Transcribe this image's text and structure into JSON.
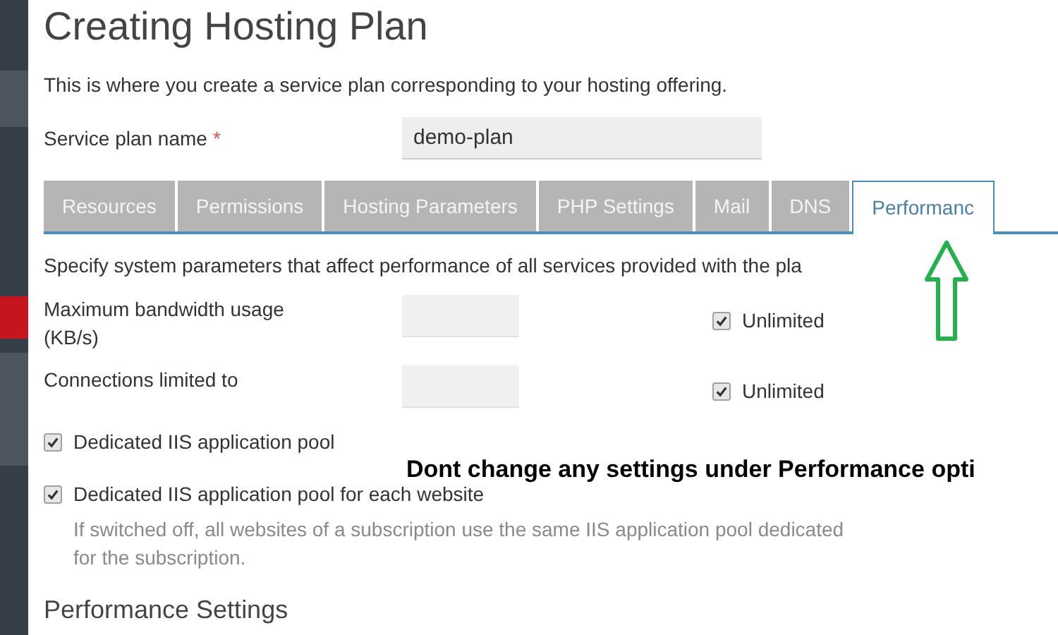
{
  "page": {
    "title": "Creating Hosting Plan",
    "intro": "This is where you create a service plan corresponding to your hosting offering."
  },
  "plan_name": {
    "label": "Service plan name",
    "required_mark": "*",
    "value": "demo-plan"
  },
  "tabs": [
    {
      "label": "Resources",
      "selected": false
    },
    {
      "label": "Permissions",
      "selected": false
    },
    {
      "label": "Hosting Parameters",
      "selected": false
    },
    {
      "label": "PHP Settings",
      "selected": false
    },
    {
      "label": "Mail",
      "selected": false
    },
    {
      "label": "DNS",
      "selected": false
    },
    {
      "label": "Performanc",
      "selected": true
    }
  ],
  "description": "Specify system parameters that affect performance of all services provided with the pla",
  "limits": [
    {
      "label": "Maximum bandwidth usage (KB/s)",
      "unlimited_label": "Unlimited",
      "unlimited": true
    },
    {
      "label": "Connections limited to",
      "unlimited_label": "Unlimited",
      "unlimited": true
    }
  ],
  "options": [
    {
      "label": "Dedicated IIS application pool",
      "checked": true
    },
    {
      "label": "Dedicated IIS application pool for each website",
      "checked": true,
      "hint": "If switched off, all websites of a subscription use the same IIS application pool dedicated for the subscription."
    }
  ],
  "section_heading": "Performance Settings",
  "annotation": "Dont change any settings under Performance opti"
}
